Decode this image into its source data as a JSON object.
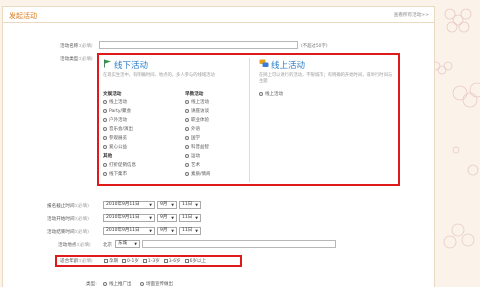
{
  "header": {
    "title": "发起活动",
    "see_all": "查看所有活动>>"
  },
  "form": {
    "name_label": "活动名称:",
    "name_req": "(必填)",
    "name_hint": "(不超过50字)",
    "type_label": "活动类型:",
    "type_req": "(必填)",
    "offline": {
      "title": "线下活动",
      "desc": "在现实生活中，有明确时间、地点的，多人参与的线域活动",
      "group1_title": "文娱活动",
      "group1_items": [
        "线上活动",
        "Party/聚会",
        "户外活动",
        "音乐会/演出",
        "参观展览",
        "爱心公益"
      ],
      "group2_title": "其他",
      "group2_items": [
        "打折促销信息",
        "线下集市"
      ],
      "group3_title": "早教活动",
      "group3_items": [
        "线上活动",
        "讲座访谈",
        "职业体验",
        "外语",
        "国学",
        "科普益智",
        "运动",
        "艺术",
        "素质/情商"
      ]
    },
    "online": {
      "title": "线上活动",
      "desc": "在网上可以进行的活动，不限城市；有明确的开始时间，或举行时间与主题",
      "items": [
        "线上活动"
      ]
    },
    "deadline_label": "报名截止时间:",
    "deadline_req": "(必填)",
    "start_label": "活动开始时间:",
    "start_req": "(必填)",
    "end_label": "活动结束时间:",
    "end_req": "(必填)",
    "date_value": "2010年9月11日",
    "month_value": "9月",
    "day_value": "11日",
    "place_label": "活动地点:",
    "place_req": "(必填)",
    "place_city": "北京",
    "place_district": "东城",
    "age_label": "适合年龄:",
    "age_req": "(必填)",
    "age_options": [
      "孕期",
      "0-1岁",
      "1-3岁",
      "3-6岁",
      "6岁以上"
    ],
    "bottom_label": "类型:",
    "bottom_options": [
      "线上推广出",
      "场面宣传做出"
    ]
  }
}
